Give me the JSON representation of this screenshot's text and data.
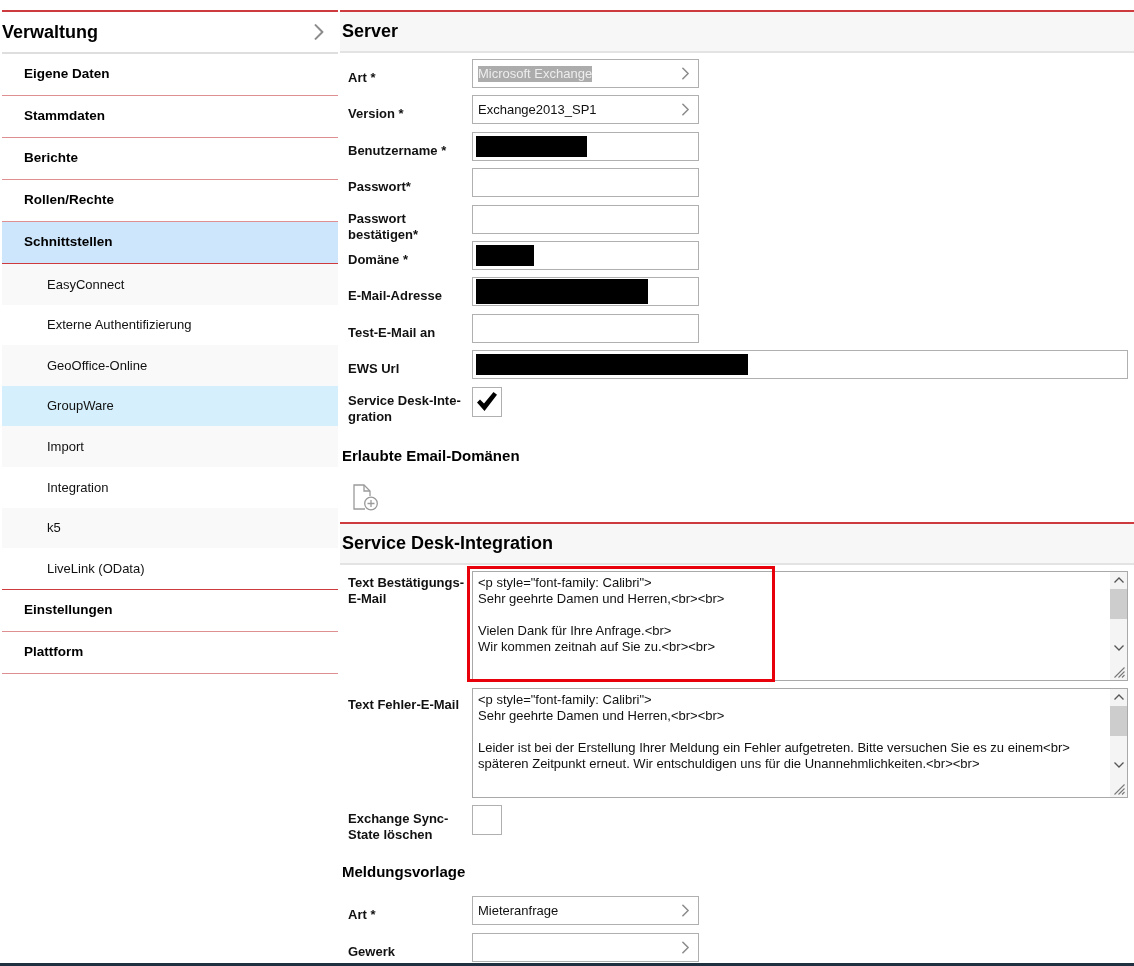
{
  "sidebar": {
    "title": "Verwaltung",
    "items": [
      {
        "label": "Eigene Daten",
        "selected": false
      },
      {
        "label": "Stammdaten",
        "selected": false
      },
      {
        "label": "Berichte",
        "selected": false
      },
      {
        "label": "Rollen/Rechte",
        "selected": false
      },
      {
        "label": "Schnittstellen",
        "selected": true,
        "children": [
          {
            "label": "EasyConnect",
            "selected": false
          },
          {
            "label": "Externe Authentifizierung",
            "selected": false
          },
          {
            "label": "GeoOffice-Online",
            "selected": false
          },
          {
            "label": "GroupWare",
            "selected": true
          },
          {
            "label": "Import",
            "selected": false
          },
          {
            "label": "Integration",
            "selected": false
          },
          {
            "label": "k5",
            "selected": false
          },
          {
            "label": "LiveLink (OData)",
            "selected": false
          }
        ]
      },
      {
        "label": "Einstellungen",
        "selected": false
      },
      {
        "label": "Plattform",
        "selected": false
      }
    ]
  },
  "sections": [
    {
      "kind": "panel",
      "title": "Server",
      "fields": [
        {
          "kind": "select",
          "label": "Art *",
          "value": "Microsoft Exchange",
          "text_selected": true
        },
        {
          "kind": "select",
          "label": "Version *",
          "value": "Exchange2013_SP1",
          "text_selected": false
        },
        {
          "kind": "text",
          "label": "Benutzername *",
          "redacted": true
        },
        {
          "kind": "text",
          "label": "Passwort*",
          "redacted": false
        },
        {
          "kind": "text",
          "label": "Passwort bestätigen*",
          "redacted": false
        },
        {
          "kind": "text",
          "label": "Domäne *",
          "redacted": true
        },
        {
          "kind": "text",
          "label": "E-Mail-Adresse",
          "redacted": true
        },
        {
          "kind": "text",
          "label": "Test-E-Mail an",
          "redacted": false
        },
        {
          "kind": "url",
          "label": "EWS Url",
          "redacted": true
        },
        {
          "kind": "checkbox",
          "label": "Service Desk-Inte-gration",
          "checked": true
        }
      ]
    },
    {
      "kind": "list",
      "title": "Erlaubte Email-Domänen"
    },
    {
      "kind": "panel",
      "title": "Service Desk-Integration",
      "fields": [
        {
          "kind": "textarea",
          "label": "Text Bestätigungs-E-Mail",
          "value": "<p style=\"font-family: Calibri\">\nSehr geehrte Damen und Herren,<br><br>\n\nVielen Dank für Ihre Anfrage.<br>\nWir kommen zeitnah auf Sie zu.<br><br>",
          "annotated": true
        },
        {
          "kind": "textarea",
          "label": "Text Fehler-E-Mail",
          "value": "<p style=\"font-family: Calibri\">\nSehr geehrte Damen und Herren,<br><br>\n\nLeider ist bei der Erstellung Ihrer Meldung ein Fehler aufgetreten. Bitte versuchen Sie es zu einem<br>\nspäteren Zeitpunkt erneut. Wir entschuldigen uns für die Unannehmlichkeiten.<br><br>",
          "annotated": false
        },
        {
          "kind": "checkbox",
          "label": "Exchange Sync-State löschen",
          "checked": false
        }
      ]
    },
    {
      "kind": "form",
      "title": "Meldungsvorlage",
      "fields": [
        {
          "kind": "select",
          "label": "Art *",
          "value": "Mieteranfrage",
          "text_selected": false
        },
        {
          "kind": "select",
          "label": "Gewerk"
        }
      ]
    }
  ]
}
